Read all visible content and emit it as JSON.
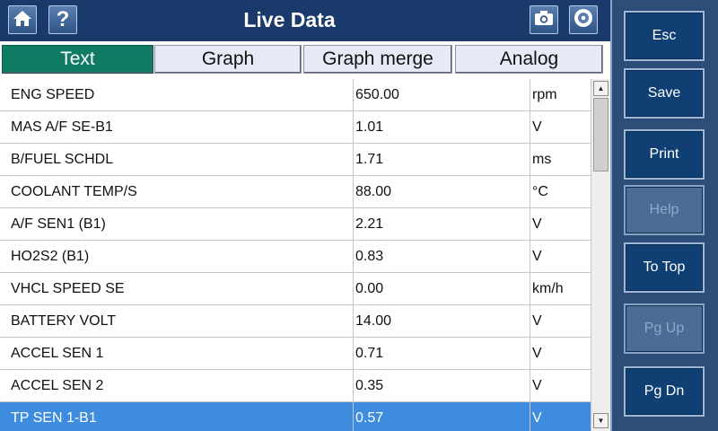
{
  "header": {
    "title": "Live Data",
    "help_label": "?"
  },
  "tabs": [
    {
      "label": "Text",
      "active": true
    },
    {
      "label": "Graph",
      "active": false
    },
    {
      "label": "Graph merge",
      "active": false
    },
    {
      "label": "Analog",
      "active": false
    }
  ],
  "rows": [
    {
      "name": "ENG SPEED",
      "value": "650.00",
      "unit": "rpm",
      "selected": false
    },
    {
      "name": "MAS A/F SE-B1",
      "value": "1.01",
      "unit": "V",
      "selected": false
    },
    {
      "name": "B/FUEL SCHDL",
      "value": "1.71",
      "unit": "ms",
      "selected": false
    },
    {
      "name": "COOLANT TEMP/S",
      "value": "88.00",
      "unit": "°C",
      "selected": false
    },
    {
      "name": "A/F SEN1 (B1)",
      "value": "2.21",
      "unit": "V",
      "selected": false
    },
    {
      "name": "HO2S2 (B1)",
      "value": "0.83",
      "unit": "V",
      "selected": false
    },
    {
      "name": "VHCL SPEED SE",
      "value": "0.00",
      "unit": "km/h",
      "selected": false
    },
    {
      "name": "BATTERY VOLT",
      "value": "14.00",
      "unit": "V",
      "selected": false
    },
    {
      "name": "ACCEL SEN 1",
      "value": "0.71",
      "unit": "V",
      "selected": false
    },
    {
      "name": "ACCEL SEN 2",
      "value": "0.35",
      "unit": "V",
      "selected": false
    },
    {
      "name": "TP SEN 1-B1",
      "value": "0.57",
      "unit": "V",
      "selected": true
    }
  ],
  "sidebar": {
    "buttons": [
      {
        "label": "Esc",
        "enabled": true
      },
      {
        "label": "Save",
        "enabled": true
      },
      {
        "label": "Print",
        "enabled": true
      },
      {
        "label": "Help",
        "enabled": false
      },
      {
        "label": "To Top",
        "enabled": true
      },
      {
        "label": "Pg Up",
        "enabled": false
      },
      {
        "label": "Pg Dn",
        "enabled": true
      }
    ]
  },
  "icons": {
    "home": "home-icon",
    "help": "help-icon",
    "camera": "camera-icon",
    "disc": "disc-icon",
    "scroll_up": "scroll-up-arrow-icon",
    "scroll_down": "scroll-down-arrow-icon"
  },
  "colors": {
    "active_tab": "#0f7b62",
    "selected_row": "#3d8ce0",
    "button_bg": "#0f3f73"
  }
}
